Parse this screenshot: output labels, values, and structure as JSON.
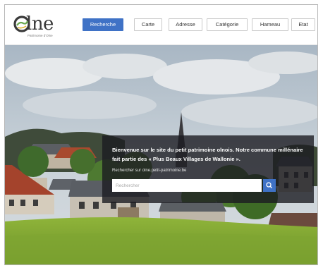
{
  "brand": {
    "name": "lne",
    "tagline": "Patrimoine d'Olne",
    "accent_color": "#3f72c6"
  },
  "nav": {
    "items": [
      {
        "label": "Recherche",
        "active": true
      },
      {
        "label": "Carte",
        "active": false
      },
      {
        "label": "Adresse",
        "active": false
      },
      {
        "label": "Catégorie",
        "active": false
      },
      {
        "label": "Hameau",
        "active": false
      },
      {
        "label": "Etat",
        "active": false
      }
    ]
  },
  "hero": {
    "welcome_text": "Bienvenue sur le site du petit patrimoine olnois. Notre commune millénaire fait partie des « Plus Beaux Villages de Wallonie ».",
    "search_label": "Rechercher sur olne.petit-patrimoine.be",
    "search_placeholder": "Rechercher",
    "search_value": "",
    "search_icon": "search-icon"
  }
}
